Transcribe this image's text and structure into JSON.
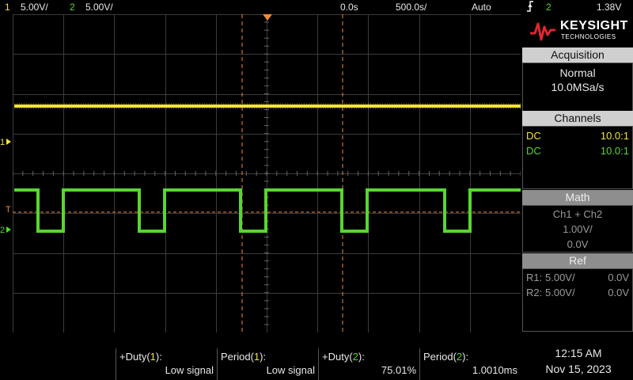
{
  "topbar": {
    "ch1_num": "1",
    "ch1_scale": "5.00V/",
    "ch2_num": "2",
    "ch2_scale": "5.00V/",
    "time_offset": "0.0s",
    "timebase": "500.0s/",
    "trigger_mode": "Auto",
    "trigger_icon": "edge-trigger-icon",
    "trigger_source": "2",
    "trigger_level": "1.38V"
  },
  "logo": {
    "brand": "KEYSIGHT",
    "subtitle": "TECHNOLOGIES"
  },
  "acquisition": {
    "title": "Acquisition",
    "mode": "Normal",
    "rate": "10.0MSa/s"
  },
  "channels": {
    "title": "Channels",
    "items": [
      {
        "coupling": "DC",
        "probe": "10.0:1",
        "color": "#f2e33a"
      },
      {
        "coupling": "DC",
        "probe": "10.0:1",
        "color": "#58d632"
      }
    ]
  },
  "math": {
    "title": "Math",
    "function": "Ch1 + Ch2",
    "scale": "1.00V/",
    "offset": "0.0V"
  },
  "ref": {
    "title": "Ref",
    "items": [
      {
        "name": "R1:",
        "scale": "5.00V/",
        "offset": "0.0V"
      },
      {
        "name": "R2:",
        "scale": "5.00V/",
        "offset": "0.0V"
      }
    ]
  },
  "measurements": [
    {
      "label": "+Duty(1):",
      "value": "Low signal"
    },
    {
      "label": "Period(1):",
      "value": "Low signal"
    },
    {
      "label": "+Duty(2):",
      "value": "75.01%"
    },
    {
      "label": "Period(2):",
      "value": "1.0010ms"
    }
  ],
  "clock": {
    "time": "12:15 AM",
    "date": "Nov 15, 2023"
  },
  "markers": {
    "ch1_label": "1",
    "ch2_label": "2",
    "trig_label": "T"
  },
  "colors": {
    "ch1": "#f2e33a",
    "ch2": "#58d632",
    "cursor": "#f08a3c",
    "grid": "#3c3c3c"
  }
}
